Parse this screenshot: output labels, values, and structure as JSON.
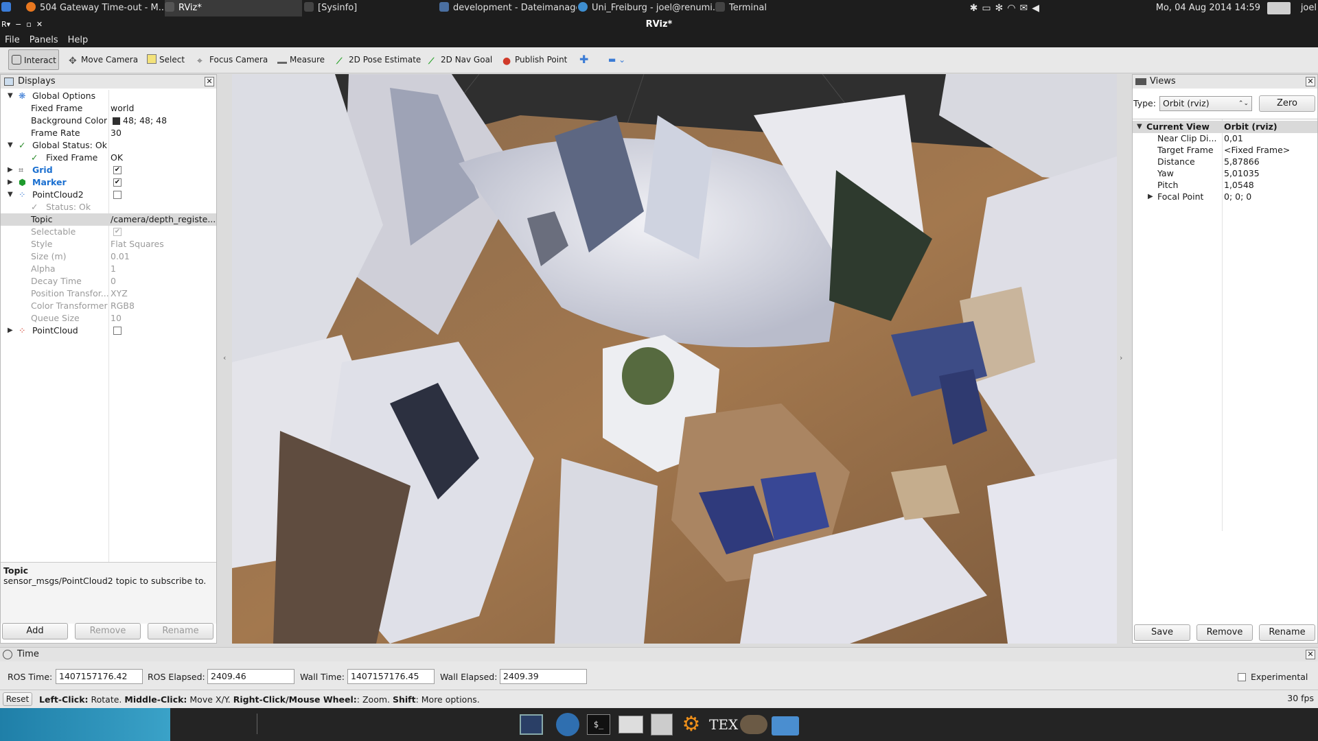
{
  "taskbar": {
    "tasks": [
      "504 Gateway Time-out - M...",
      "RViz*",
      "[Sysinfo]",
      "development - Dateimanager",
      "Uni_Freiburg - joel@renumi...",
      "Terminal"
    ],
    "datetime": "Mo, 04 Aug 2014 14:59",
    "user": "joel"
  },
  "window": {
    "title": "RViz*"
  },
  "menu": [
    "File",
    "Panels",
    "Help"
  ],
  "toolbar": {
    "tools": [
      "Interact",
      "Move Camera",
      "Select",
      "Focus Camera",
      "Measure",
      "2D Pose Estimate",
      "2D Nav Goal",
      "Publish Point"
    ],
    "active": "Interact"
  },
  "displays": {
    "title": "Displays",
    "rows": [
      {
        "label": "Global Options",
        "value": ""
      },
      {
        "label": "Fixed Frame",
        "value": "world"
      },
      {
        "label": "Background Color",
        "value": "48; 48; 48"
      },
      {
        "label": "Frame Rate",
        "value": "30"
      },
      {
        "label": "Global Status: Ok",
        "value": ""
      },
      {
        "label": "Fixed Frame",
        "value": "OK"
      },
      {
        "label": "Grid",
        "value": ""
      },
      {
        "label": "Marker",
        "value": ""
      },
      {
        "label": "PointCloud2",
        "value": ""
      },
      {
        "label": "Status: Ok",
        "value": ""
      },
      {
        "label": "Topic",
        "value": "/camera/depth_registe..."
      },
      {
        "label": "Selectable",
        "value": ""
      },
      {
        "label": "Style",
        "value": "Flat Squares"
      },
      {
        "label": "Size (m)",
        "value": "0.01"
      },
      {
        "label": "Alpha",
        "value": "1"
      },
      {
        "label": "Decay Time",
        "value": "0"
      },
      {
        "label": "Position Transfor...",
        "value": "XYZ"
      },
      {
        "label": "Color Transformer",
        "value": "RGB8"
      },
      {
        "label": "Queue Size",
        "value": "10"
      },
      {
        "label": "PointCloud",
        "value": ""
      }
    ],
    "description_title": "Topic",
    "description_text": "sensor_msgs/PointCloud2 topic to subscribe to.",
    "buttons": [
      "Add",
      "Remove",
      "Rename"
    ]
  },
  "views": {
    "title": "Views",
    "type_label": "Type:",
    "type_value": "Orbit (rviz)",
    "zero_button": "Zero",
    "rows": [
      {
        "label": "Current View",
        "value": "Orbit (rviz)"
      },
      {
        "label": "Near Clip Di...",
        "value": "0,01"
      },
      {
        "label": "Target Frame",
        "value": "<Fixed Frame>"
      },
      {
        "label": "Distance",
        "value": "5,87866"
      },
      {
        "label": "Yaw",
        "value": "5,01035"
      },
      {
        "label": "Pitch",
        "value": "1,0548"
      },
      {
        "label": "Focal Point",
        "value": "0; 0; 0"
      }
    ],
    "buttons": [
      "Save",
      "Remove",
      "Rename"
    ]
  },
  "time": {
    "title": "Time",
    "ros_time_label": "ROS Time:",
    "ros_time": "1407157176.42",
    "ros_elapsed_label": "ROS Elapsed:",
    "ros_elapsed": "2409.46",
    "wall_time_label": "Wall Time:",
    "wall_time": "1407157176.45",
    "wall_elapsed_label": "Wall Elapsed:",
    "wall_elapsed": "2409.39",
    "experimental": "Experimental"
  },
  "statusbar": {
    "reset": "Reset",
    "k1": "Left-Click:",
    "t1": " Rotate. ",
    "k2": "Middle-Click:",
    "t2": " Move X/Y. ",
    "k3": "Right-Click/Mouse Wheel:",
    "t3": ": Zoom. ",
    "k4": "Shift",
    "t4": ": More options.",
    "fps": "30 fps"
  },
  "colors": {
    "accent": "#1a6fd0",
    "chrome": "#1d1d1d",
    "bg_swatch": "#303030"
  }
}
